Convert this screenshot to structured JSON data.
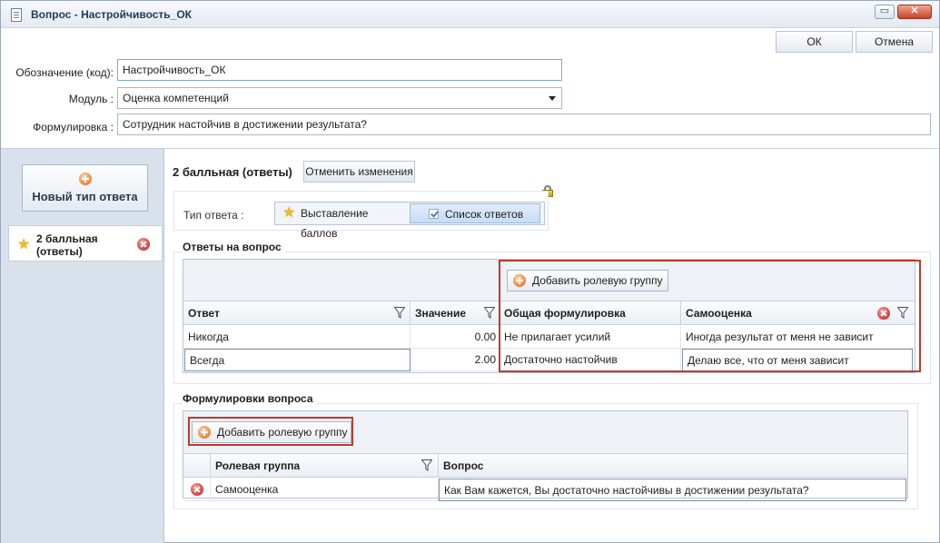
{
  "window": {
    "title": "Вопрос - Настройчивость_ОК",
    "close_glyph": "✕",
    "max_glyph": "▭"
  },
  "toolbar": {
    "ok_label": "ОК",
    "cancel_label": "Отмена"
  },
  "form": {
    "code_label": "Обозначение (код):",
    "code_value": "Настройчивость_ОК",
    "module_label": "Модуль :",
    "module_value": "Оценка компетенций",
    "wording_label": "Формулировка :",
    "wording_value": "Сотрудник настойчив в достижении результата?"
  },
  "sidebar": {
    "new_type_label": "Новый тип ответа",
    "items": [
      {
        "label_line1": "2 балльная",
        "label_line2": "(ответы)"
      }
    ]
  },
  "content": {
    "title": "2 балльная (ответы)",
    "revert_label": "Отменить изменения",
    "answer_type_label": "Тип ответа :",
    "answer_type_options": [
      "Выставление баллов",
      "Список ответов"
    ],
    "answer_type_selected": "Список ответов",
    "answers_section_title": "Ответы на вопрос",
    "add_role_group_label": "Добавить ролевую группу",
    "answers_columns": [
      "Ответ",
      "Значение",
      "Общая формулировка",
      "Самооценка"
    ],
    "answers_rows": [
      {
        "answer": "Никогда",
        "value": "0.00",
        "general": "Не прилагает усилий",
        "self": "Иногда результат от меня не зависит"
      },
      {
        "answer": "Всегда",
        "value": "2.00",
        "general": "Достаточно настойчив",
        "self": "Делаю все, что от меня зависит"
      }
    ],
    "wordings_section_title": "Формулировки вопроса",
    "wordings_columns": [
      "Ролевая группа",
      "Вопрос"
    ],
    "wordings_rows": [
      {
        "group": "Самооценка",
        "question": "Как Вам кажется, Вы достаточно настойчивы в достижении результата?"
      }
    ]
  },
  "colors": {
    "highlight": "#c0392b",
    "sidebar_bg": "#d9e1ec",
    "selected_segment": "#c9dcf4"
  }
}
